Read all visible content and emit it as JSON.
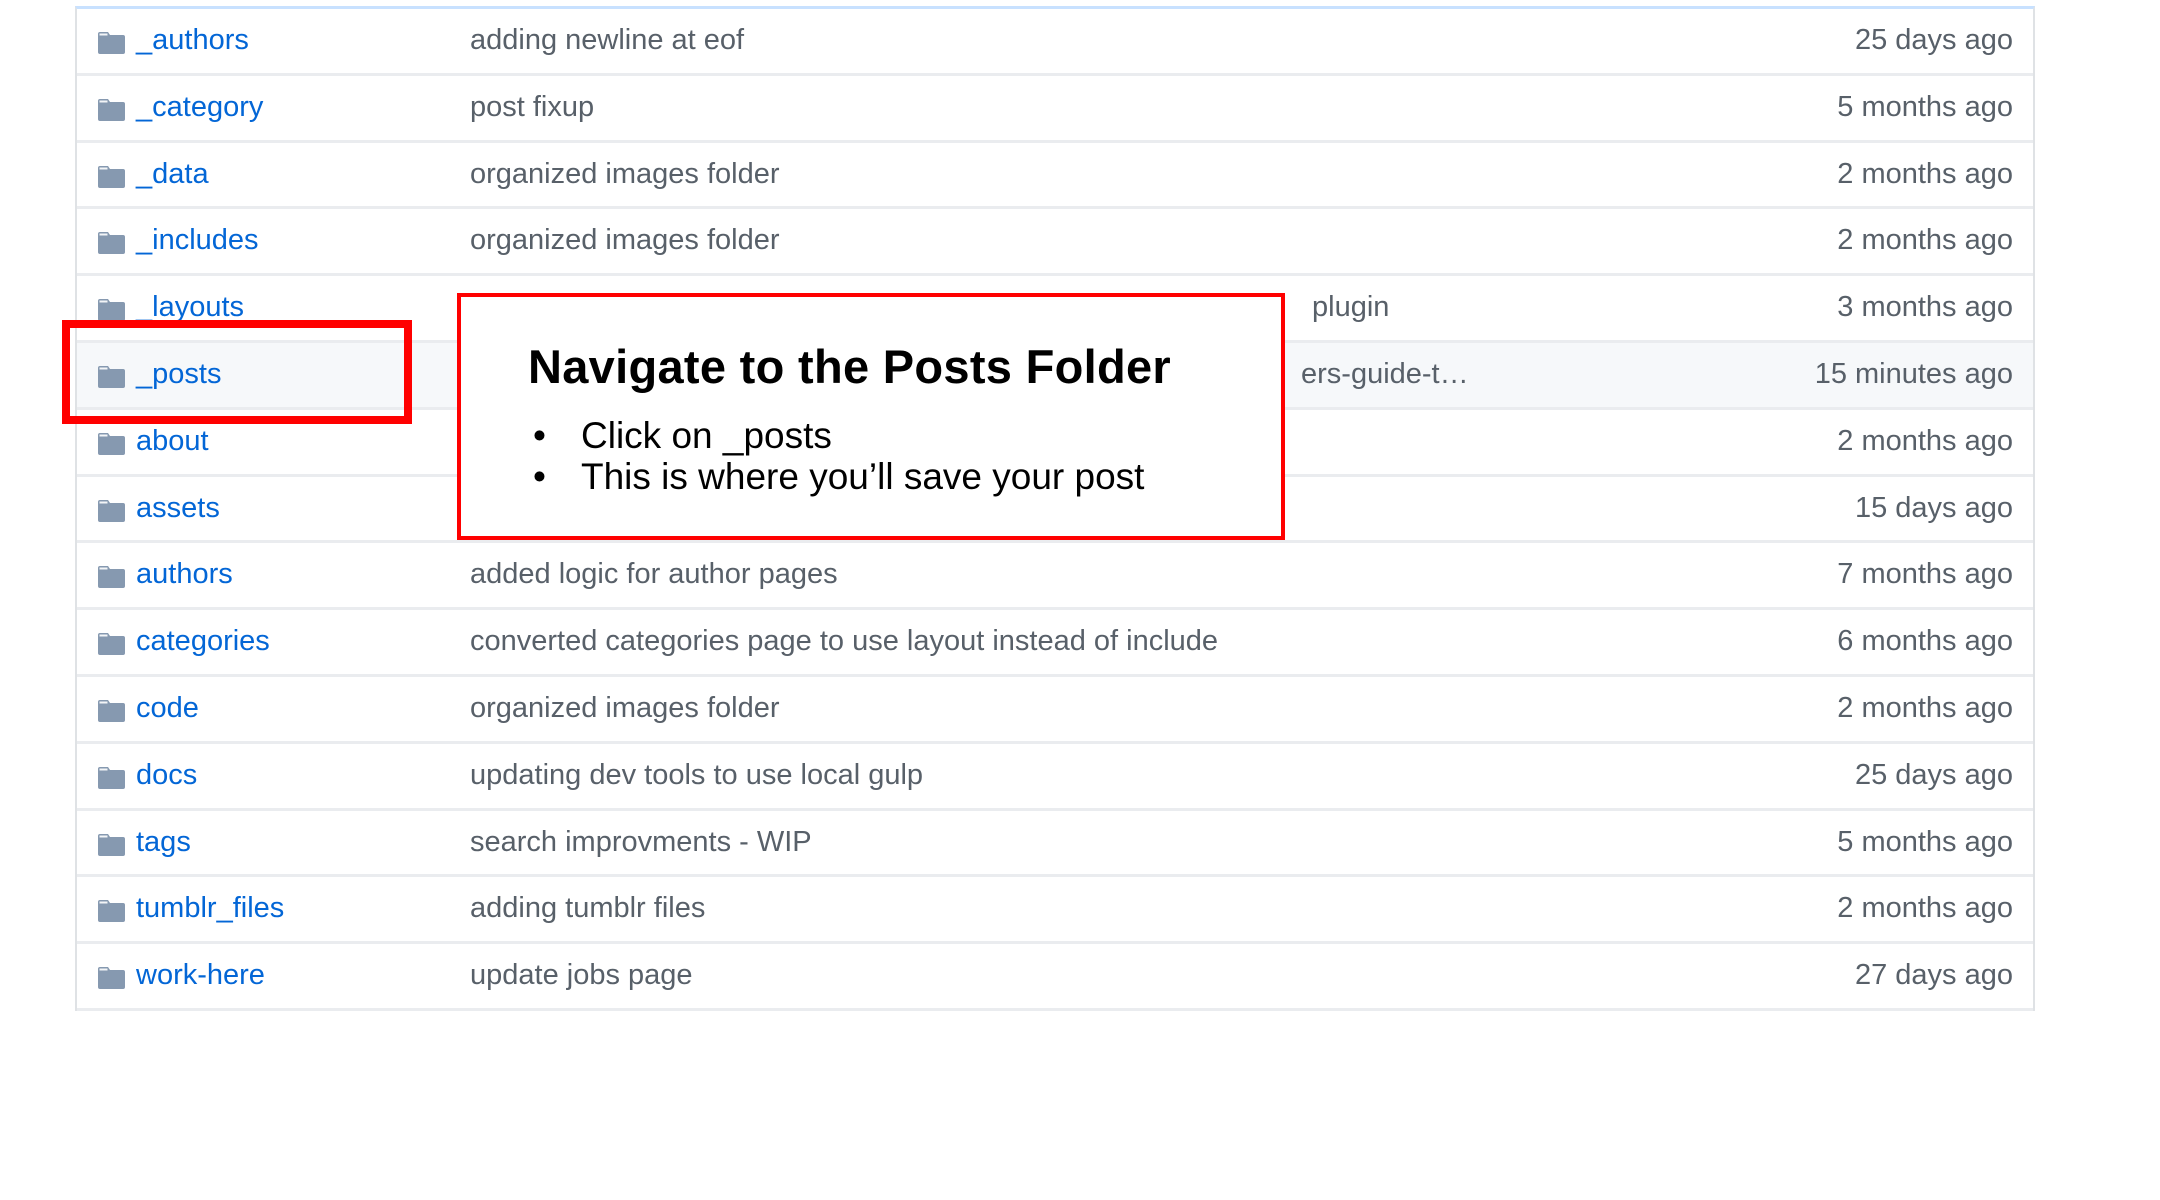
{
  "file_list": {
    "rows": [
      {
        "name": "_authors",
        "message": "adding newline at eof",
        "age": "25 days ago",
        "icon": "folder-icon"
      },
      {
        "name": "_category",
        "message": "post fixup",
        "age": "5 months ago",
        "icon": "folder-icon"
      },
      {
        "name": "_data",
        "message": "organized images folder",
        "age": "2 months ago",
        "icon": "folder-icon"
      },
      {
        "name": "_includes",
        "message": "organized images folder",
        "age": "2 months ago",
        "icon": "folder-icon"
      },
      {
        "name": "_layouts",
        "message": "plugin",
        "age": "3 months ago",
        "icon": "folder-icon"
      },
      {
        "name": "_posts",
        "message": "ers-guide-t…",
        "age": "15 minutes ago",
        "icon": "folder-icon",
        "highlighted": true
      },
      {
        "name": "about",
        "message": "",
        "age": "2 months ago",
        "icon": "folder-icon"
      },
      {
        "name": "assets",
        "message": "",
        "age": "15 days ago",
        "icon": "folder-icon"
      },
      {
        "name": "authors",
        "message": "added logic for author pages",
        "age": "7 months ago",
        "icon": "folder-icon"
      },
      {
        "name": "categories",
        "message": "converted categories page to use layout instead of include",
        "age": "6 months ago",
        "icon": "folder-icon"
      },
      {
        "name": "code",
        "message": "organized images folder",
        "age": "2 months ago",
        "icon": "folder-icon"
      },
      {
        "name": "docs",
        "message": "updating dev tools to use local gulp",
        "age": "25 days ago",
        "icon": "folder-icon"
      },
      {
        "name": "tags",
        "message": "search improvments - WIP",
        "age": "5 months ago",
        "icon": "folder-icon"
      },
      {
        "name": "tumblr_files",
        "message": "adding tumblr files",
        "age": "2 months ago",
        "icon": "folder-icon"
      },
      {
        "name": "work-here",
        "message": "update jobs page",
        "age": "27 days ago",
        "icon": "folder-icon"
      }
    ]
  },
  "callout": {
    "title": "Navigate to the Posts Folder",
    "bullets": [
      "Click on _posts",
      "This is where you’ll save your post"
    ],
    "bullet_glyph": "•"
  },
  "colors": {
    "link": "#0366d6",
    "muted_text": "#586069",
    "folder_icon": "#8699b0",
    "annotation_red": "#ff0000",
    "highlight_row": "#f6f8fa"
  }
}
